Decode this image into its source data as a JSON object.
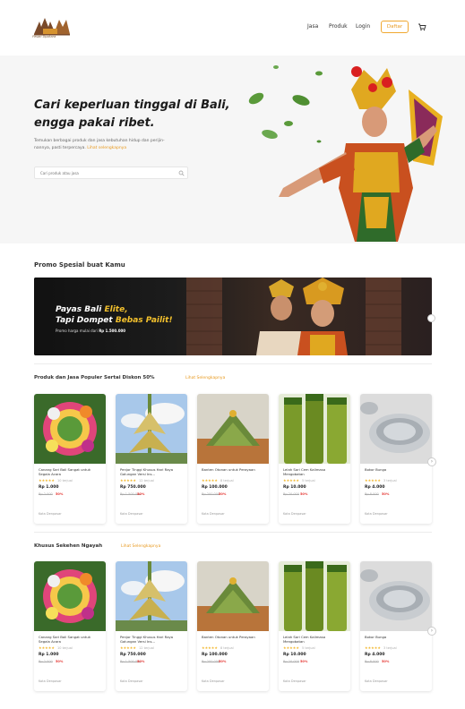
{
  "nav": {
    "logo_text": "Pesan Upakara",
    "links": [
      "Jasa",
      "Produk",
      "Login"
    ],
    "register_label": "Daftar"
  },
  "hero": {
    "title_line1": "Cari keperluan tinggal di Bali,",
    "title_line2": "engga pakai ribet.",
    "description": "Temukan berbagai produk dan jasa kebutuhan hidup dan perijin-",
    "description_line2": "nannya, pasti terpercaya.",
    "description_link": "Lihat selengkapnya",
    "search_placeholder": "Cari produk atau jasa"
  },
  "promo": {
    "section_title": "Promo Spesial buat Kamu",
    "banner_line1_prefix": "Payas Bali ",
    "banner_line1_highlight": "Elite,",
    "banner_line2_prefix": "Tapi Dompet ",
    "banner_line2_highlight": "Bebas Pailit!",
    "banner_sub_prefix": "Promo harga mulai dari ",
    "banner_sub_price": "Rp 1.500.000"
  },
  "section_popular": {
    "title": "Produk dan Jasa Populer Sertai Diskon 50%",
    "link": "Lihat Selengkapnya"
  },
  "section_ngayah": {
    "title": "Khusus Sekehen Ngayah",
    "link": "Lihat Selengkapnya"
  },
  "products": [
    {
      "name": "Canang Sari Bali Sangat untuk Segala Acara",
      "stars": "★★★★★",
      "sold": "10 terjual",
      "price": "Rp 1.000",
      "old_price": "Rp 2.000",
      "discount": "50%",
      "location": "Kota Denpasar",
      "image": "flower-offering"
    },
    {
      "name": "Penjor Tinggi Khusus Hari Raya Galungan Versi Ins...",
      "stars": "★★★★★",
      "sold": "12 terjual",
      "price": "Rp 750.000",
      "old_price": "Rp 1.500.000",
      "discount": "50%",
      "location": "Kota Denpasar",
      "image": "penjor"
    },
    {
      "name": "Banten Otonan untuk Perayaan",
      "stars": "★★★★★",
      "sold": "8 terjual",
      "price": "Rp 100.000",
      "old_price": "Rp 200.000",
      "discount": "50%",
      "location": "Kota Denpasar",
      "image": "banten"
    },
    {
      "name": "Lelah Sari Cem Kalimasa Mengobatan",
      "stars": "★★★★★",
      "sold": "5 terjual",
      "price": "Rp 10.000",
      "old_price": "Rp 20.000",
      "discount": "50%",
      "location": "Kota Denpasar",
      "image": "bottles"
    },
    {
      "name": "Bokor Bunga",
      "stars": "★★★★★",
      "sold": "3 terjual",
      "price": "Rp 4.000",
      "old_price": "Rp 8.000",
      "discount": "50%",
      "location": "Kota Denpasar",
      "image": "bokor"
    }
  ],
  "products2": [
    {
      "name": "Canang Sari Bali Sangat untuk Segala Acara",
      "stars": "★★★★★",
      "sold": "10 terjual",
      "price": "Rp 1.000",
      "old_price": "Rp 2.000",
      "discount": "50%",
      "location": "Kota Denpasar",
      "image": "flower-offering"
    },
    {
      "name": "Penjor Tinggi Khusus Hari Raya Galungan Versi Ins...",
      "stars": "★★★★★",
      "sold": "12 terjual",
      "price": "Rp 750.000",
      "old_price": "Rp 1.500.000",
      "discount": "50%",
      "location": "Kota Denpasar",
      "image": "penjor"
    },
    {
      "name": "Banten Otonan untuk Perayaan",
      "stars": "★★★★★",
      "sold": "8 terjual",
      "price": "Rp 100.000",
      "old_price": "Rp 200.000",
      "discount": "50%",
      "location": "Kota Denpasar",
      "image": "banten"
    },
    {
      "name": "Lelah Sari Cem Kalimasa Mengobatan",
      "stars": "★★★★★",
      "sold": "5 terjual",
      "price": "Rp 10.000",
      "old_price": "Rp 20.000",
      "discount": "50%",
      "location": "Kota Denpasar",
      "image": "bottles"
    },
    {
      "name": "Bokor Bunga",
      "stars": "★★★★★",
      "sold": "3 terjual",
      "price": "Rp 4.000",
      "old_price": "Rp 8.000",
      "discount": "50%",
      "location": "Kota Denpasar",
      "image": "bokor"
    }
  ],
  "colors": {
    "accent": "#e89a20",
    "discount": "#e53935",
    "star": "#f2b72d",
    "gold": "#f2c02d"
  }
}
